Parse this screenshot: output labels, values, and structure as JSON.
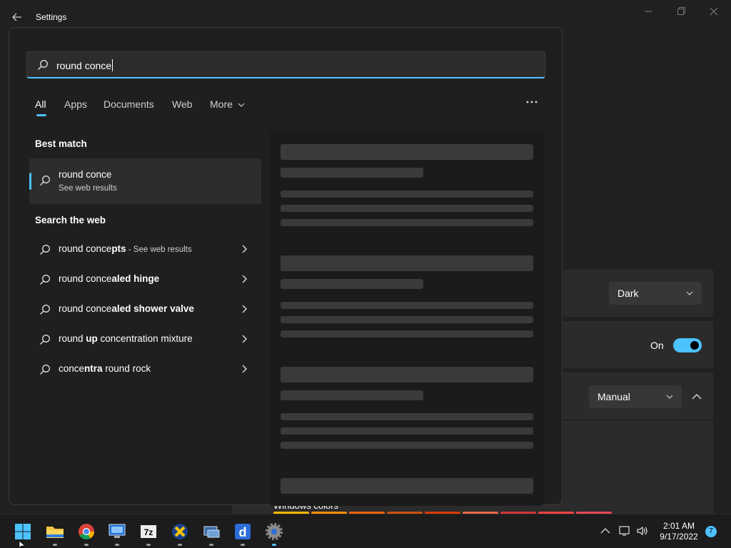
{
  "window": {
    "title": "Settings"
  },
  "settings_rows": {
    "mode_value": "Dark",
    "transparency_value": "On",
    "accent_value": "Manual",
    "windows_colors_label": "Windows colors"
  },
  "search": {
    "query": "round conce",
    "tabs": [
      {
        "label": "All",
        "active": true
      },
      {
        "label": "Apps",
        "active": false
      },
      {
        "label": "Documents",
        "active": false
      },
      {
        "label": "Web",
        "active": false
      },
      {
        "label": "More",
        "active": false
      }
    ],
    "best_match_title": "Best match",
    "best_match": {
      "title": "round conce",
      "subtitle": "See web results"
    },
    "web_title": "Search the web",
    "web_results": [
      {
        "prefix": "round conce",
        "bold": "pts",
        "rest": "",
        "suffix": " - See web results"
      },
      {
        "prefix": "round conce",
        "bold": "aled hinge",
        "rest": "",
        "suffix": ""
      },
      {
        "prefix": "round conce",
        "bold": "aled shower valve",
        "rest": "",
        "suffix": ""
      },
      {
        "prefix": "round ",
        "bold": "up",
        "rest": " concentration mixture",
        "suffix": ""
      },
      {
        "prefix": "conce",
        "bold": "ntra",
        "rest": " round rock",
        "suffix": ""
      }
    ]
  },
  "taskbar": {
    "apps": [
      "start-button",
      "file-explorer",
      "chrome",
      "remote-desktop",
      "7zip",
      "xampp",
      "network-tool",
      "dropbox-d",
      "settings"
    ],
    "time": "2:01 AM",
    "date": "9/17/2022",
    "notifications": "7"
  },
  "colors": {
    "accent": "#4cc2ff",
    "flyout_bg": "#1f1f1f",
    "window_bg": "#202020"
  }
}
